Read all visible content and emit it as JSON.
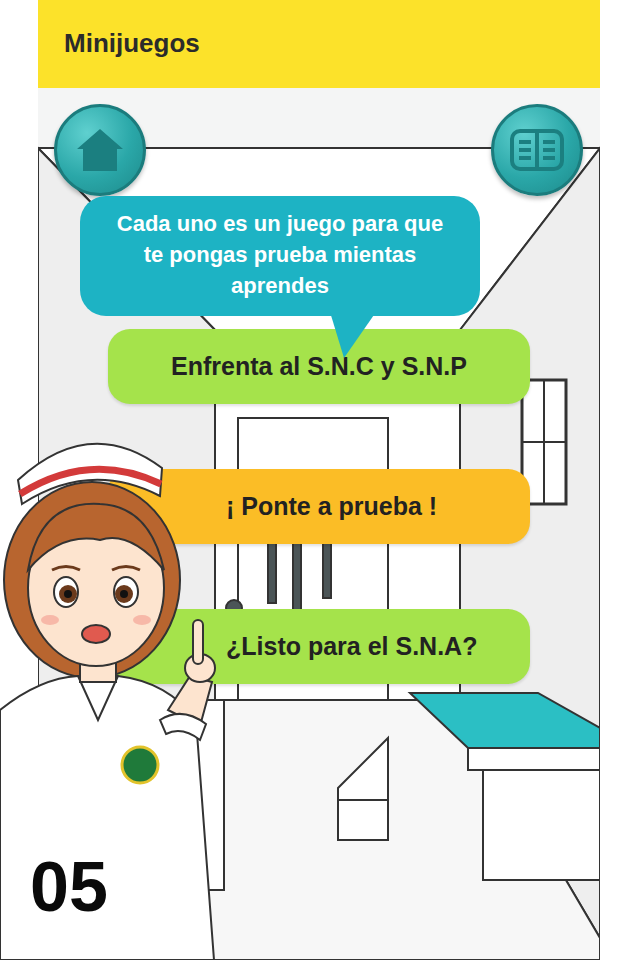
{
  "app_bar": {
    "title": "Minijuegos"
  },
  "speech_bubble": {
    "text": "Cada uno es un juego para que te pongas prueba mientas aprendes"
  },
  "games": [
    {
      "label": "Enfrenta al S.N.C y S.N.P",
      "color": "#a5e34b"
    },
    {
      "label": "¡ Ponte a prueba !",
      "color": "#fbbd26"
    },
    {
      "label": "¿Listo para el S.N.A?",
      "color": "#a5e34b"
    }
  ],
  "page_number": "05"
}
